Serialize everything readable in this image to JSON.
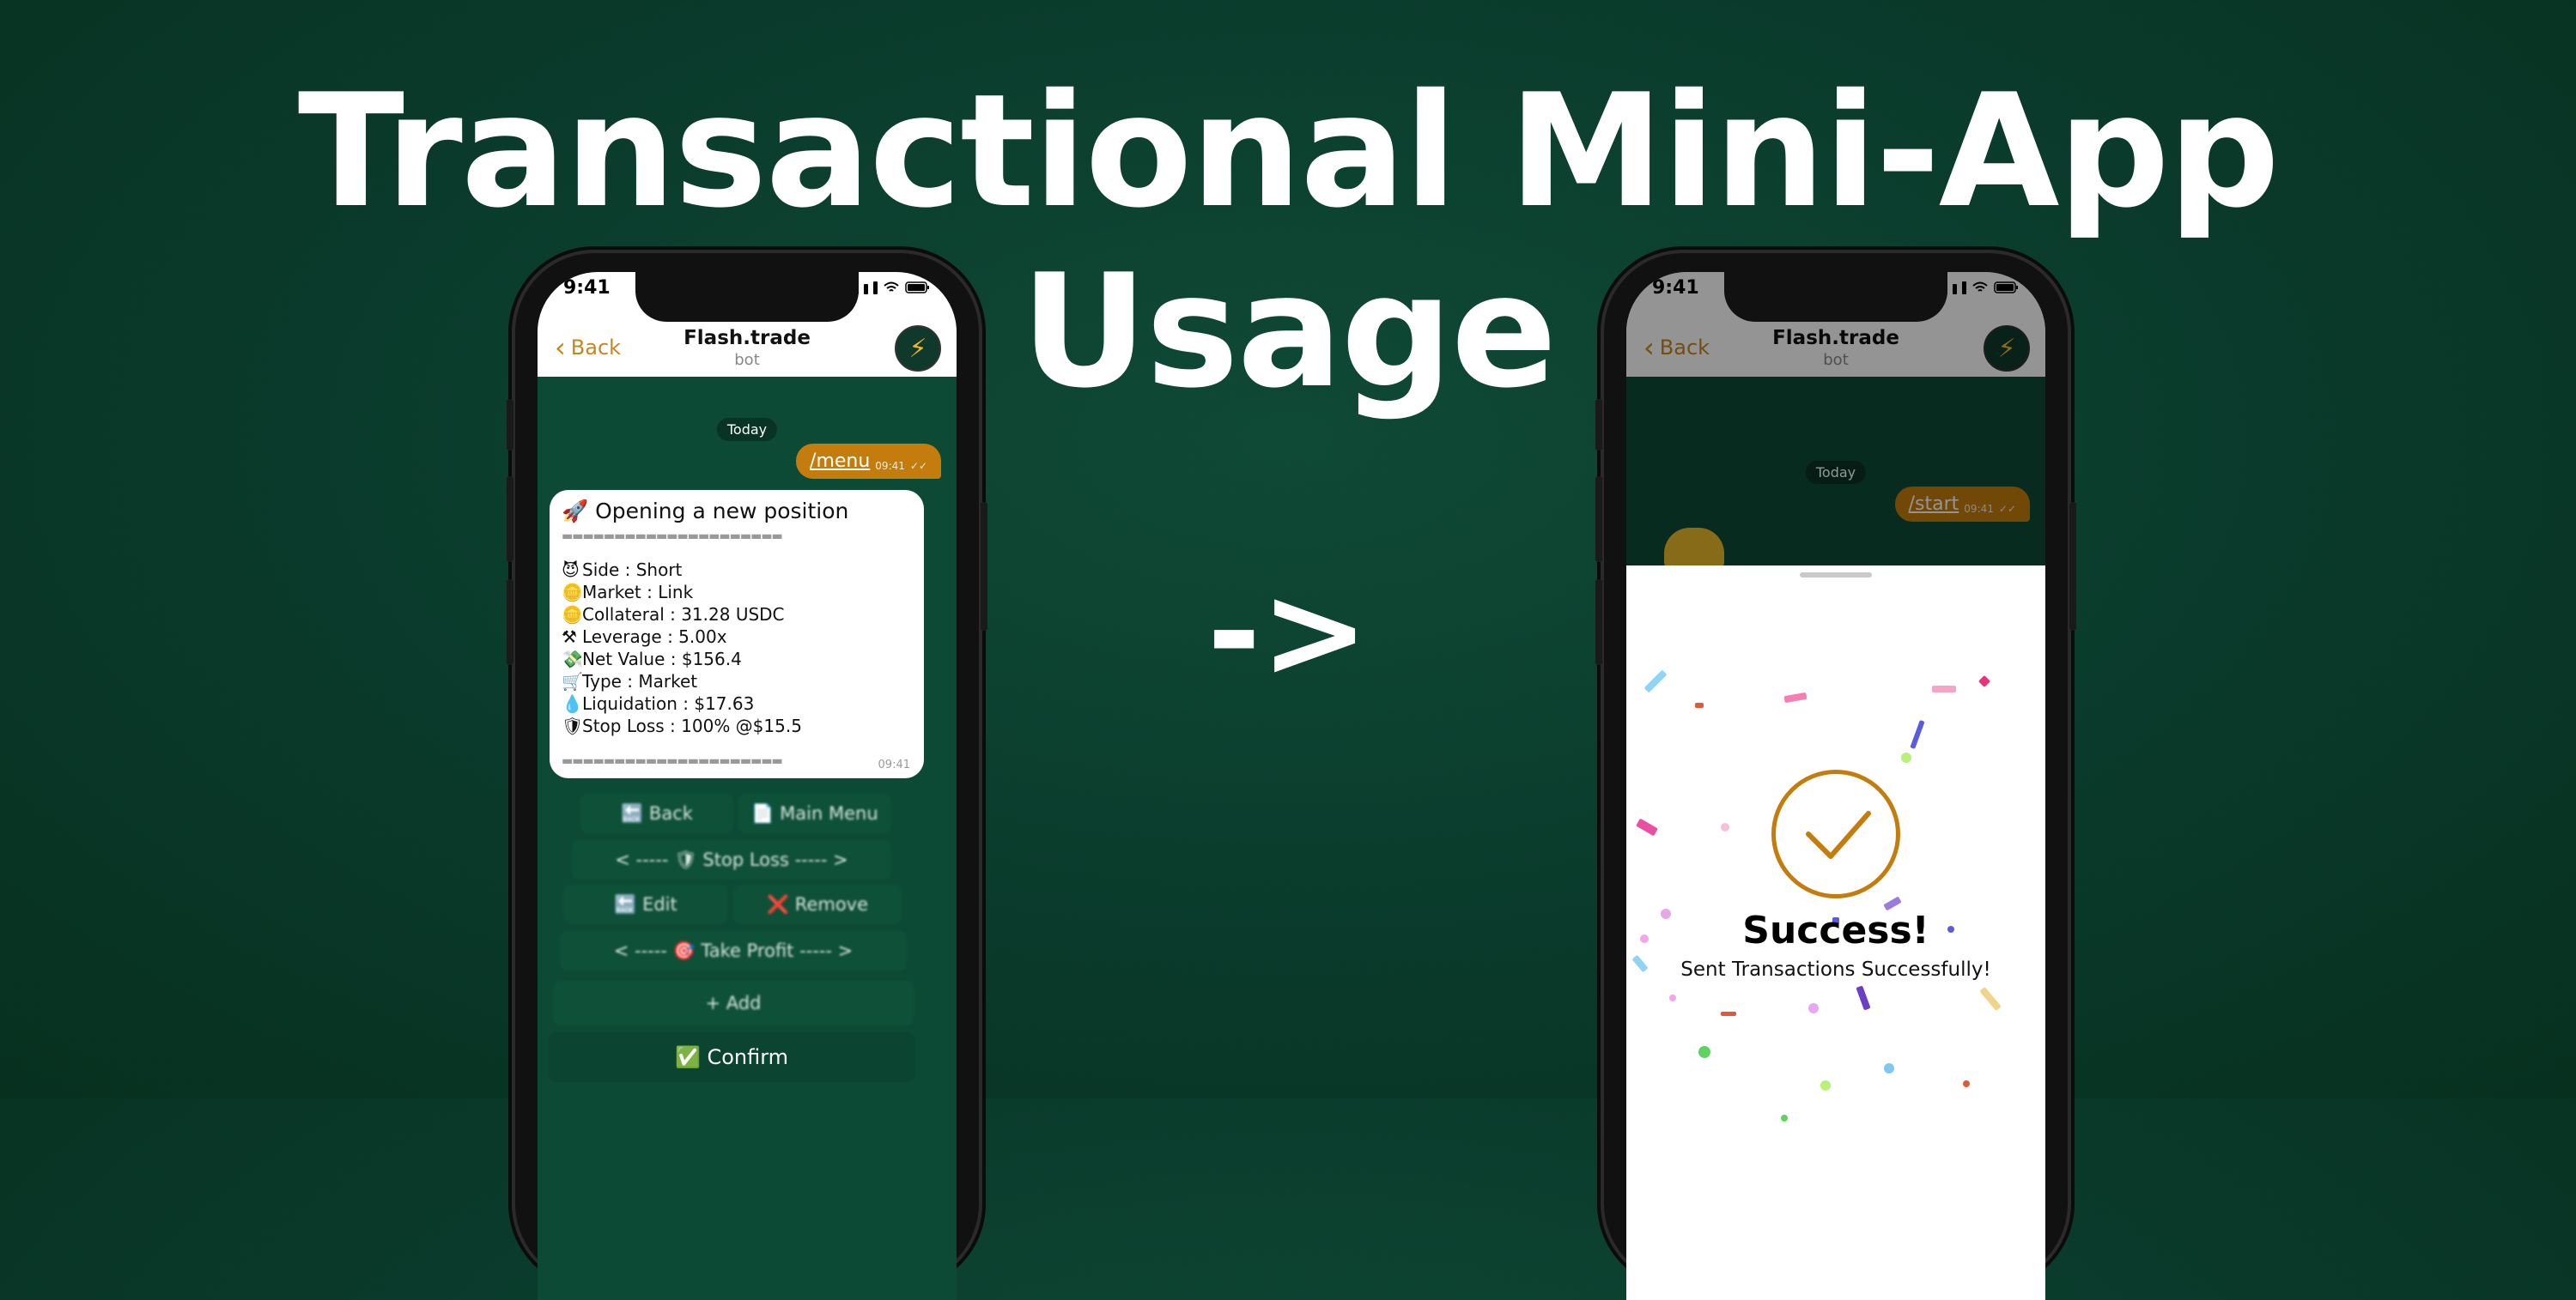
{
  "headline": {
    "line1": "Transactional Mini-App",
    "line2": "Usage"
  },
  "arrow": "->",
  "left_phone": {
    "time": "9:41",
    "header": {
      "back": "Back",
      "title": "Flash.trade",
      "subtitle": "bot"
    },
    "date_chip": "Today",
    "sent_message": {
      "text": "/menu",
      "time": "09:41"
    },
    "bot_message": {
      "title": "🚀 Opening a new position",
      "rule": "▬▬▬▬▬▬▬▬▬▬▬▬▬▬▬▬▬▬▬▬▬",
      "lines": [
        {
          "icon": "😈",
          "text": "Side :   Short"
        },
        {
          "icon": "🪙",
          "text": "Market :   Link"
        },
        {
          "icon": "🪙",
          "text": "Collateral :   31.28 USDC"
        },
        {
          "icon": "⚒",
          "text": "Leverage :   5.00x"
        },
        {
          "icon": "💸",
          "text": "Net Value :   $156.4"
        },
        {
          "icon": "🛒",
          "text": "Type :   Market"
        },
        {
          "icon": "💧",
          "text": "Liquidation : $17.63"
        },
        {
          "icon": "🛡",
          "text": "Stop Loss :   100% @$15.5"
        }
      ],
      "time": "09:41"
    },
    "keyboard": {
      "back": "🔙 Back",
      "main_menu": "📄 Main Menu",
      "stop_loss": "< ----- 🛡 Stop Loss ----- >",
      "edit": "🔙 Edit",
      "remove": "❌ Remove",
      "take_profit": "< ----- 🎯 Take Profit ----- >",
      "add": "+ Add",
      "confirm": "✅ Confirm"
    }
  },
  "right_phone": {
    "time": "9:41",
    "header": {
      "back": "Back",
      "title": "Flash.trade",
      "subtitle": "bot"
    },
    "date_chip": "Today",
    "sent_message": {
      "text": "/start",
      "time": "09:41"
    },
    "success": {
      "title": "Success!",
      "subtitle": "Sent Transactions Successfully!"
    }
  },
  "colors": {
    "background": "#0b3d2d",
    "accent": "#c47c0c",
    "chat_bg": "#0d4a36"
  }
}
